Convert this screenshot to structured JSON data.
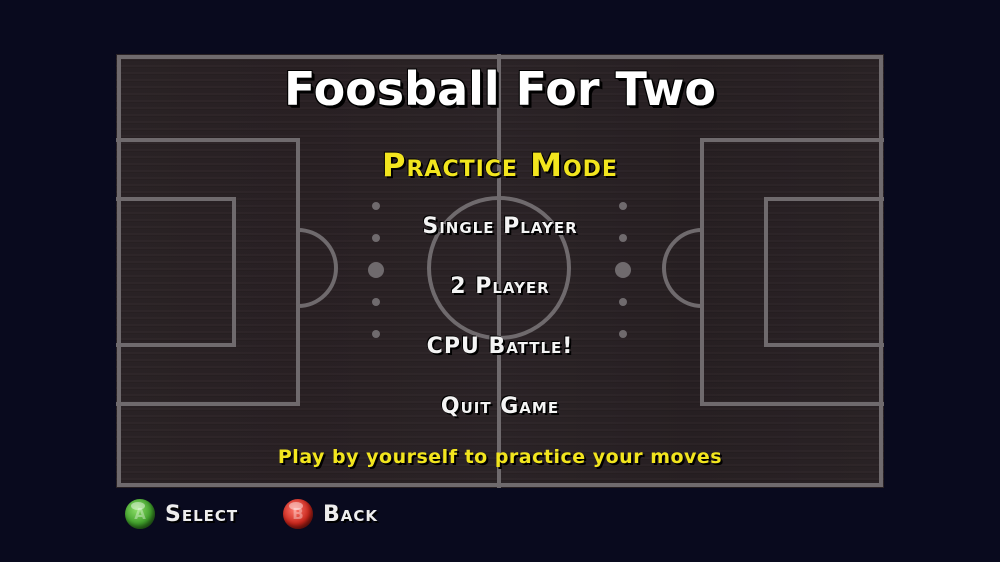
{
  "title": "Foosball For Two",
  "mode_label": "Practice Mode",
  "menu": {
    "items": [
      {
        "label": "Single Player"
      },
      {
        "label": "2 Player"
      },
      {
        "label": "CPU Battle!"
      },
      {
        "label": "Quit Game"
      }
    ],
    "selected_index": 0
  },
  "description": "Play by yourself to practice your moves",
  "controls": {
    "select": {
      "button": "A",
      "label": "Select",
      "icon": "a-button-icon",
      "color": "#3f9e2a"
    },
    "back": {
      "button": "B",
      "label": "Back",
      "icon": "b-button-icon",
      "color": "#c8261c"
    }
  },
  "colors": {
    "background": "#090a1e",
    "board": "#2b2326",
    "field_lines": "#6f6a6d",
    "highlight": "#f2e51e",
    "menu_text": "#f4f4f4"
  }
}
